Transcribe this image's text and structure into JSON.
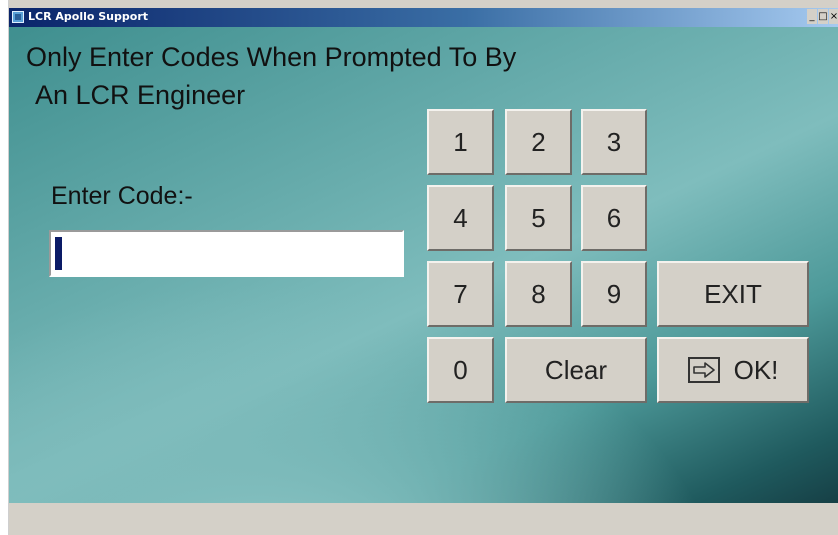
{
  "window": {
    "title": "LCR Apollo Support",
    "minimize_glyph": "_",
    "maximize_glyph": "□",
    "close_glyph": "×"
  },
  "prompt": {
    "line1": "Only Enter Codes When Prompted To By",
    "line2": "An LCR Engineer"
  },
  "code_entry": {
    "label": "Enter Code:-",
    "value": ""
  },
  "keypad": {
    "keys": [
      "1",
      "2",
      "3",
      "4",
      "5",
      "6",
      "7",
      "8",
      "9",
      "0"
    ],
    "clear_label": "Clear",
    "exit_label": "EXIT",
    "ok_label": "OK!"
  },
  "icons": {
    "app": "app-icon",
    "ok": "arrow-right-icon"
  },
  "colors": {
    "titlebar": "#0a246a",
    "background_teal": "#6db0b0",
    "button_face": "#d4d0c8"
  }
}
